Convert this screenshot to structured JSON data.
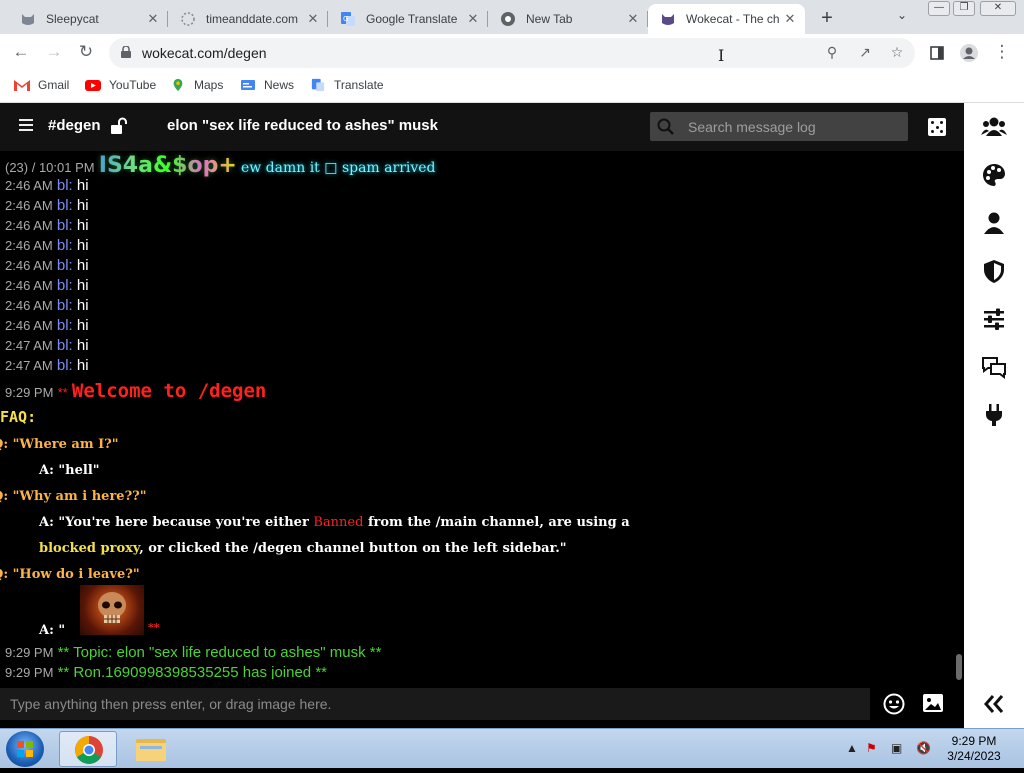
{
  "browser": {
    "tabs": [
      {
        "title": "Sleepycat",
        "icon": "cat-icon"
      },
      {
        "title": "timeanddate.com",
        "icon": "timeanddate-icon"
      },
      {
        "title": "Google Translate",
        "icon": "translate-icon"
      },
      {
        "title": "New Tab",
        "icon": "chrome-icon"
      },
      {
        "title": "Wokecat - The ch",
        "icon": "cat-icon"
      }
    ],
    "url": "wokecat.com/degen",
    "bookmarks": [
      "Gmail",
      "YouTube",
      "Maps",
      "News",
      "Translate"
    ]
  },
  "chat": {
    "channel": "#degen",
    "topic": "elon \"sex life reduced to ashes\" musk",
    "search_placeholder": "Search message log",
    "composer_placeholder": "Type anything then press enter, or drag image here.",
    "first_line": {
      "prefix": "(23) / 10:01 PM",
      "nick": "IS4a&$op+",
      "text": "ew damn it □ spam arrived"
    },
    "messages": [
      {
        "time": "2:46 AM",
        "nick": "bl:",
        "text": "hi"
      },
      {
        "time": "2:46 AM",
        "nick": "bl:",
        "text": "hi"
      },
      {
        "time": "2:46 AM",
        "nick": "bl:",
        "text": "hi"
      },
      {
        "time": "2:46 AM",
        "nick": "bl:",
        "text": "hi"
      },
      {
        "time": "2:46 AM",
        "nick": "bl:",
        "text": "hi"
      },
      {
        "time": "2:46 AM",
        "nick": "bl:",
        "text": "hi"
      },
      {
        "time": "2:46 AM",
        "nick": "bl:",
        "text": "hi"
      },
      {
        "time": "2:46 AM",
        "nick": "bl:",
        "text": "hi"
      },
      {
        "time": "2:47 AM",
        "nick": "bl:",
        "text": "hi"
      },
      {
        "time": "2:47 AM",
        "nick": "bl:",
        "text": "hi"
      }
    ],
    "welcome": {
      "time": "9:29 PM",
      "stars": "**",
      "text": "Welcome to /degen"
    },
    "faq": {
      "heading": "FAQ:",
      "q1": "Q: \"Where am I?\"",
      "a1": "A: \"hell\"",
      "q2": "Q: \"Why am i here??\"",
      "a2_part1": "A: \"You're here because you're either ",
      "a2_banned": "Banned",
      "a2_part2": " from the /main channel, are using a",
      "a2_blocked": "blocked proxy",
      "a2_part3": ", or clicked the /degen channel button on the left sidebar.\"",
      "q3": "Q: \"How do i leave?\"",
      "a3": "A: \"",
      "a3_stars": "**"
    },
    "system": [
      {
        "time": "9:29 PM",
        "text": "** Topic: elon \"sex life reduced to ashes\" musk **"
      },
      {
        "time": "9:29 PM",
        "text": "** Ron.1690998398535255 has joined **"
      }
    ]
  },
  "taskbar": {
    "time": "9:29 PM",
    "date": "3/24/2023"
  }
}
